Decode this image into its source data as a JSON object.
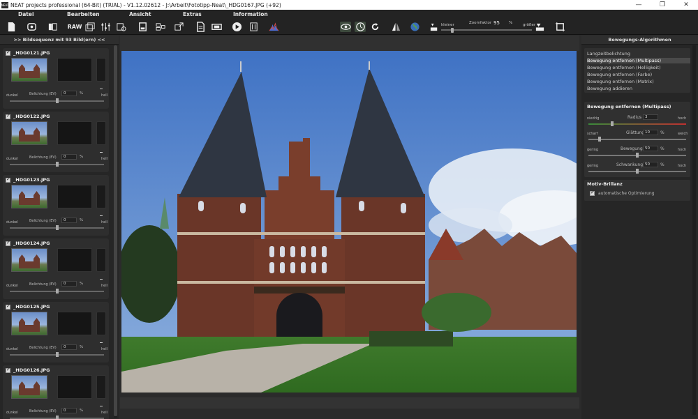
{
  "window": {
    "title": "NEAT projects professional (64-Bit) (TRIAL) - V1.12.02612 - J:\\Arbeit\\Fototipp-Neat\\_HDG0167.JPG (+92)",
    "logo_text": "NEAT",
    "minimize": "—",
    "maximize": "❐",
    "close": "✕"
  },
  "menu": {
    "datei": "Datei",
    "bearbeiten": "Bearbeiten",
    "ansicht": "Ansicht",
    "extras": "Extras",
    "information": "Information"
  },
  "toolbar": {
    "raw_label": "RAW",
    "zoom_label": "Zoomfaktor",
    "zoom_value": "95",
    "zoom_unit": "%",
    "smaller_label": "kleiner",
    "bigger_label": "größer"
  },
  "left_panel": {
    "header": ">> Bildsequenz mit 93 Bild(ern) <<",
    "frames": [
      {
        "name": "_HDG0121.JPG",
        "dark": "dunkel",
        "exposure_label": "Belichtung (EV)",
        "exposure_value": "0",
        "unit": "%",
        "light": "hell",
        "exposure_level": 0.5
      },
      {
        "name": "_HDG0122.JPG",
        "dark": "dunkel",
        "exposure_label": "Belichtung (EV)",
        "exposure_value": "0",
        "unit": "%",
        "light": "hell",
        "exposure_level": 0.5
      },
      {
        "name": "_HDG0123.JPG",
        "dark": "dunkel",
        "exposure_label": "Belichtung (EV)",
        "exposure_value": "0",
        "unit": "%",
        "light": "hell",
        "exposure_level": 0.5
      },
      {
        "name": "_HDG0124.JPG",
        "dark": "dunkel",
        "exposure_label": "Belichtung (EV)",
        "exposure_value": "0",
        "unit": "%",
        "light": "hell",
        "exposure_level": 0.5
      },
      {
        "name": "_HDG0125.JPG",
        "dark": "dunkel",
        "exposure_label": "Belichtung (EV)",
        "exposure_value": "0",
        "unit": "%",
        "light": "hell",
        "exposure_level": 0.5
      },
      {
        "name": "_HDG0126.JPG",
        "dark": "dunkel",
        "exposure_label": "Belichtung (EV)",
        "exposure_value": "0",
        "unit": "%",
        "light": "hell",
        "exposure_level": 0.5
      }
    ]
  },
  "right_panel": {
    "header": "Bewegungs-Algorithmen",
    "algorithms": [
      "Langzeitbelichtung",
      "Bewegung entfernen (Multipass)",
      "Bewegung entfernen (Helligkeit)",
      "Bewegung entfernen (Farbe)",
      "Bewegung entfernen (Matrix)",
      "Bewegung addieren"
    ],
    "selected_index": 1,
    "settings": {
      "title": "Bewegung entfernen (Multipass)",
      "radius": {
        "low": "niedrig",
        "label": "Radius",
        "value": "3",
        "high": "hoch"
      },
      "smoothing": {
        "low": "scharf",
        "label": "Glättung",
        "value": "10",
        "unit": "%",
        "high": "weich"
      },
      "motion": {
        "low": "gering",
        "label": "Bewegung",
        "value": "50",
        "unit": "%",
        "high": "hoch"
      },
      "variation": {
        "low": "gering",
        "label": "Schwankung",
        "value": "50",
        "unit": "%",
        "high": "hoch"
      }
    },
    "brilliance": {
      "title": "Motiv-Brillanz",
      "auto_label": "automatische Optimierung"
    }
  },
  "colors": {
    "radius_gradient_start": "#3a8a3a",
    "radius_gradient_end": "#c03030"
  }
}
